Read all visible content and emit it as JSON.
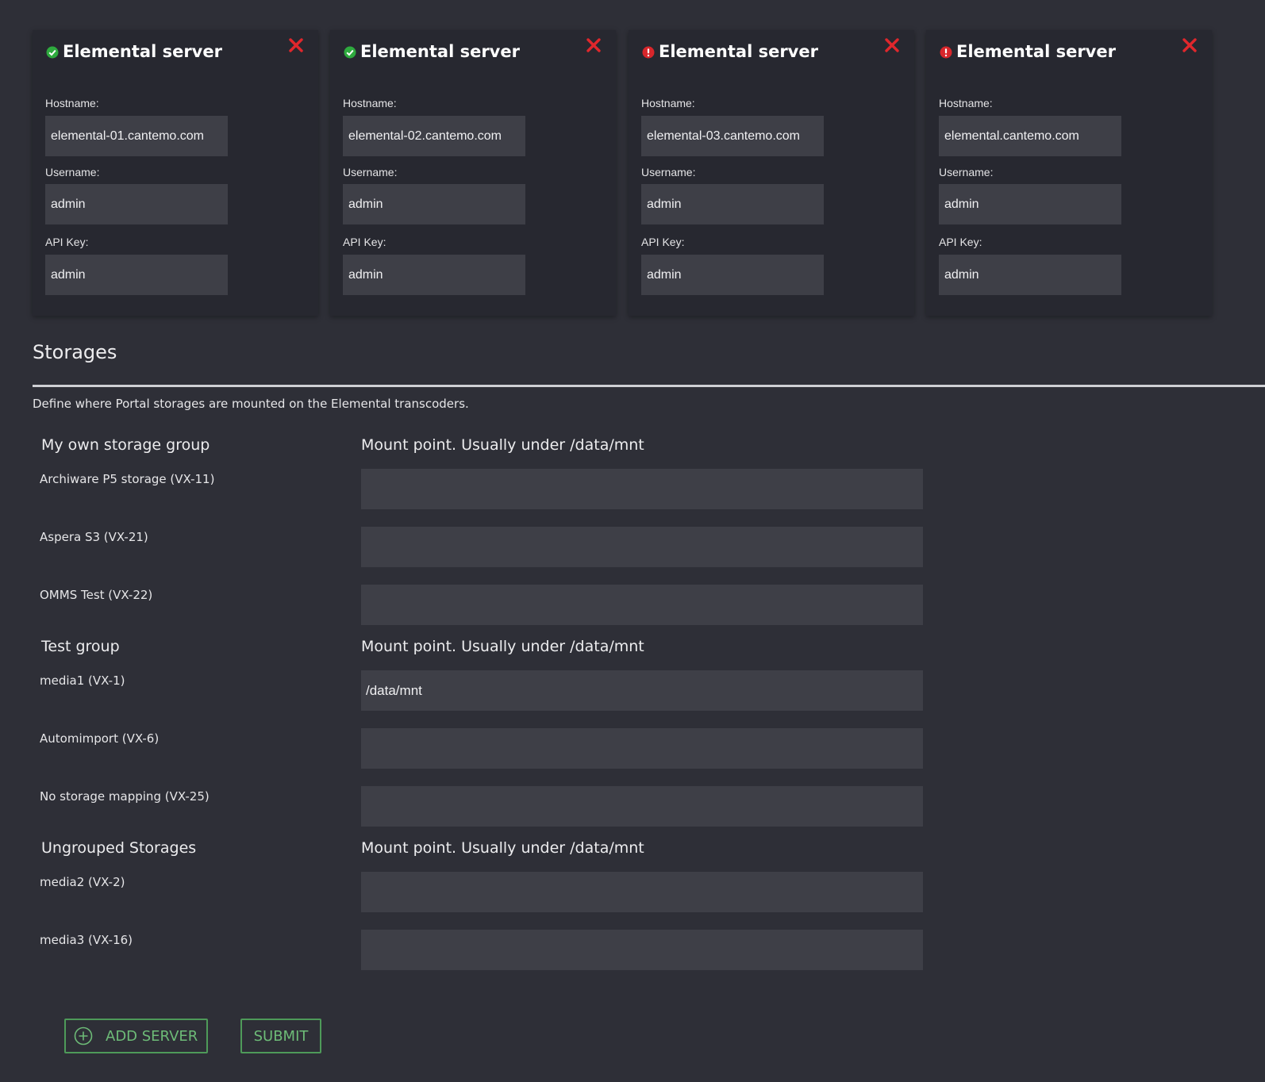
{
  "servers": [
    {
      "title": "Elemental server",
      "status": "ok",
      "status_icon": "check-circle-icon",
      "hostname": "elemental-01.cantemo.com",
      "username": "admin",
      "api_key": "admin"
    },
    {
      "title": "Elemental server",
      "status": "ok",
      "status_icon": "check-circle-icon",
      "hostname": "elemental-02.cantemo.com",
      "username": "admin",
      "api_key": "admin"
    },
    {
      "title": "Elemental server",
      "status": "error",
      "status_icon": "exclamation-circle-icon",
      "hostname": "elemental-03.cantemo.com",
      "username": "admin",
      "api_key": "admin"
    },
    {
      "title": "Elemental server",
      "status": "error",
      "status_icon": "exclamation-circle-icon",
      "hostname": "elemental.cantemo.com",
      "username": "admin",
      "api_key": "admin"
    }
  ],
  "labels": {
    "hostname": "Hostname:",
    "username": "Username:",
    "api_key": "API Key:"
  },
  "storages": {
    "title": "Storages",
    "description": "Define where Portal storages are mounted on the Elemental transcoders.",
    "groups": [
      {
        "name": "My own storage group",
        "mount_heading": "Mount point. Usually under /data/mnt",
        "items": [
          {
            "label": "Archiware P5 storage (VX-11)",
            "value": ""
          },
          {
            "label": "Aspera S3 (VX-21)",
            "value": ""
          },
          {
            "label": "OMMS Test (VX-22)",
            "value": ""
          }
        ]
      },
      {
        "name": "Test group",
        "mount_heading": "Mount point. Usually under /data/mnt",
        "items": [
          {
            "label": "media1 (VX-1)",
            "value": "/data/mnt"
          },
          {
            "label": "Automimport (VX-6)",
            "value": ""
          },
          {
            "label": "No storage mapping (VX-25)",
            "value": ""
          }
        ]
      },
      {
        "name": "Ungrouped Storages",
        "mount_heading": "Mount point. Usually under /data/mnt",
        "items": [
          {
            "label": "media2 (VX-2)",
            "value": ""
          },
          {
            "label": "media3 (VX-16)",
            "value": ""
          }
        ]
      }
    ]
  },
  "actions": {
    "add_server": "ADD SERVER",
    "submit": "SUBMIT"
  },
  "colors": {
    "ok": "#2eaa3e",
    "error": "#d8262b",
    "close": "#e0272c",
    "accent": "#4e9a59"
  },
  "icons": {
    "close": "close-icon",
    "add": "plus-circle-icon"
  }
}
